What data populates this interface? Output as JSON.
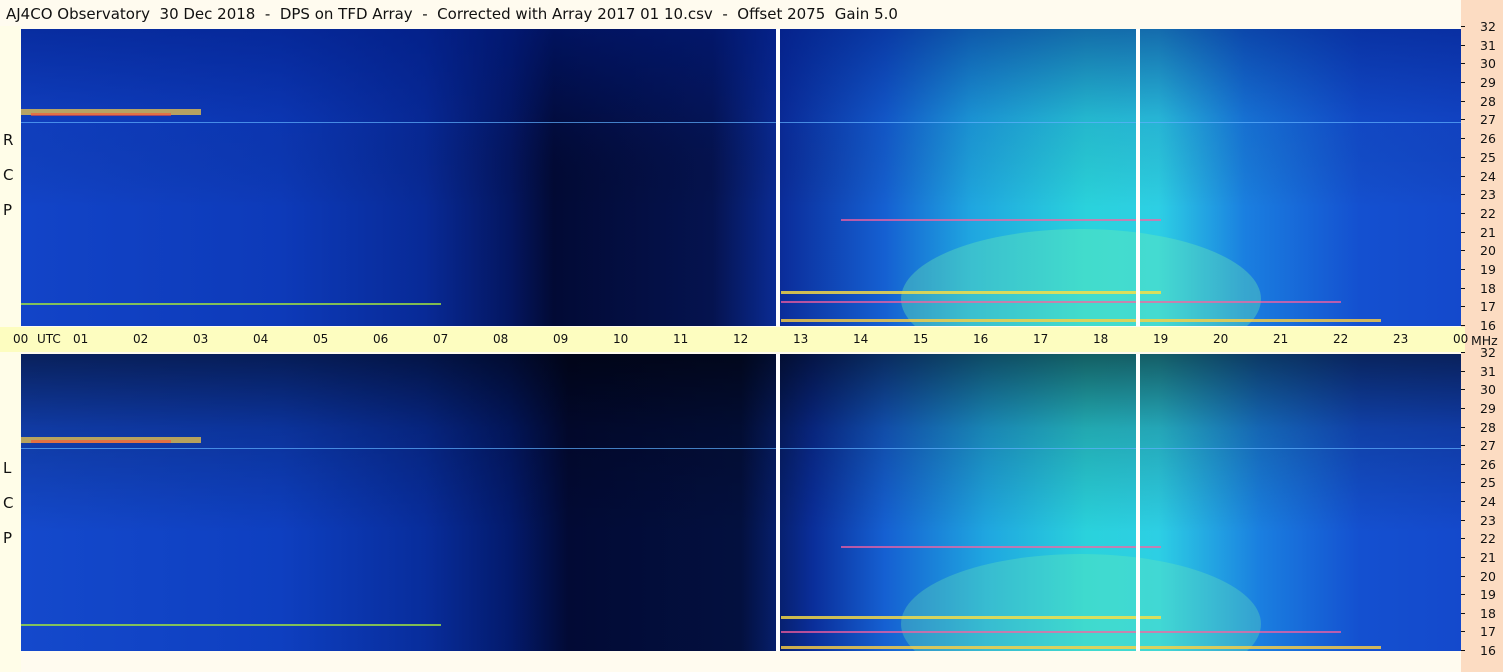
{
  "title": "AJ4CO Observatory  30 Dec 2018  -  DPS on TFD Array  -  Corrected with Array 2017 01 10.csv  -  Offset 2075  Gain 5.0",
  "panels": [
    {
      "name": "rcp",
      "label": [
        "R",
        "C",
        "P"
      ]
    },
    {
      "name": "lcp",
      "label": [
        "L",
        "C",
        "P"
      ]
    }
  ],
  "time_axis": {
    "utc_label": "UTC",
    "ticks": [
      "00",
      "01",
      "02",
      "03",
      "04",
      "05",
      "06",
      "07",
      "08",
      "09",
      "10",
      "11",
      "12",
      "13",
      "14",
      "15",
      "16",
      "17",
      "18",
      "19",
      "20",
      "21",
      "22",
      "23",
      "00"
    ]
  },
  "freq_axis": {
    "unit": "MHz",
    "ticks": [
      "32",
      "31",
      "30",
      "29",
      "28",
      "27",
      "26",
      "25",
      "24",
      "23",
      "22",
      "21",
      "20",
      "19",
      "18",
      "17",
      "16"
    ]
  },
  "colors": {
    "background_blue": "#0b33b8",
    "dark_region": "#020a3a",
    "bright_region": "#2fd3e0",
    "utc_bar": "#fdfdc0",
    "right_strip": "#fcdcc2"
  },
  "chart_data": {
    "type": "heatmap",
    "title": "AJ4CO Observatory  30 Dec 2018  -  DPS on TFD Array  -  Corrected with Array 2017 01 10.csv  -  Offset 2075  Gain 5.0",
    "x_label": "UTC",
    "x_range": [
      "00",
      "00"
    ],
    "y_label": "MHz",
    "y_range": [
      16,
      32
    ],
    "panels": [
      "R C P",
      "L C P"
    ]
  }
}
